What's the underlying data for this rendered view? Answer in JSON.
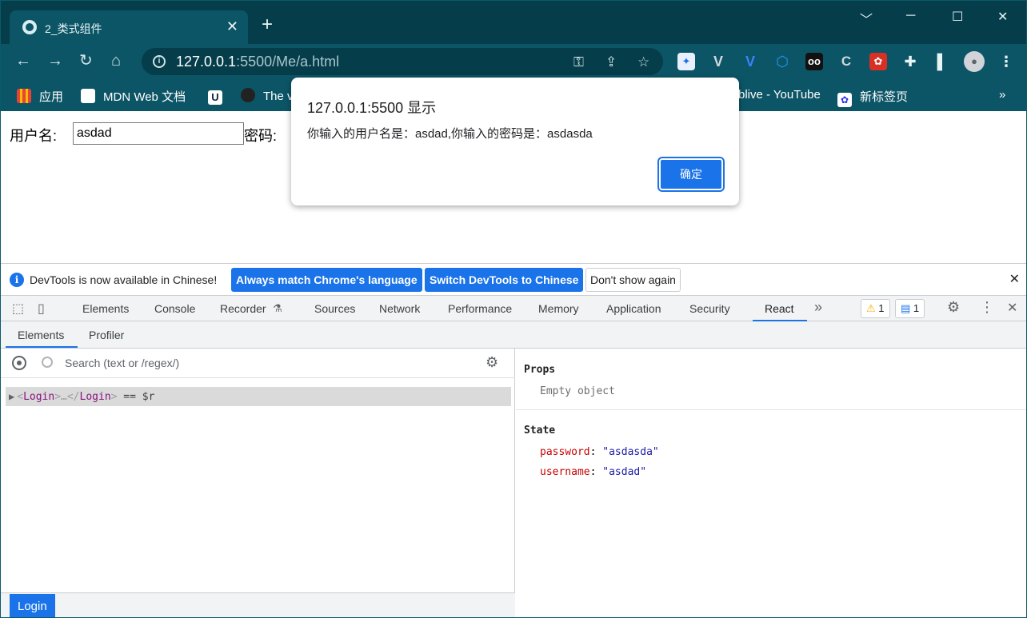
{
  "browser": {
    "tab_title": "2_类式组件",
    "url_host": "127.0.0.1",
    "url_rest": ":5500/Me/a.html",
    "window_controls": {
      "minimize": "﹀",
      "restore": "─",
      "maximize": "☐",
      "close": "✕"
    }
  },
  "bookmarks": [
    {
      "label": "应用",
      "icon": "apps-grid-icon"
    },
    {
      "label": "MDN Web 文档",
      "icon": "mdn-icon"
    },
    {
      "label": "",
      "icon": "u-icon"
    },
    {
      "label": "The v",
      "icon": "github-icon"
    },
    {
      "label": "blive - YouTube",
      "icon": "youtube-icon"
    },
    {
      "label": "新标签页",
      "icon": "baidu-icon"
    }
  ],
  "page": {
    "username_label": "用户名:",
    "username_value": "asdad",
    "password_label": "密码:"
  },
  "dialog": {
    "title": "127.0.0.1:5500 显示",
    "message": "你输入的用户名是：asdad,你输入的密码是：asdasda",
    "ok_label": "确定"
  },
  "infobar": {
    "message": "DevTools is now available in Chinese!",
    "btn_match": "Always match Chrome's language",
    "btn_switch": "Switch DevTools to Chinese",
    "btn_dismiss": "Don't show again"
  },
  "devtools": {
    "tabs": [
      "Elements",
      "Console",
      "Recorder",
      "Sources",
      "Network",
      "Performance",
      "Memory",
      "Application",
      "Security",
      "React"
    ],
    "active_tab": "React",
    "warnings_count": "1",
    "messages_count": "1"
  },
  "react": {
    "subtabs": [
      "Elements",
      "Profiler"
    ],
    "search_placeholder": "Search (text or /regex/)",
    "tree_component": "Login",
    "tree_suffix": " == $r",
    "breadcrumb": "Login",
    "props_heading": "Props",
    "props_empty": "Empty object",
    "state_heading": "State",
    "state": [
      {
        "key": "password",
        "value": "\"asdasda\""
      },
      {
        "key": "username",
        "value": "\"asdad\""
      }
    ]
  }
}
